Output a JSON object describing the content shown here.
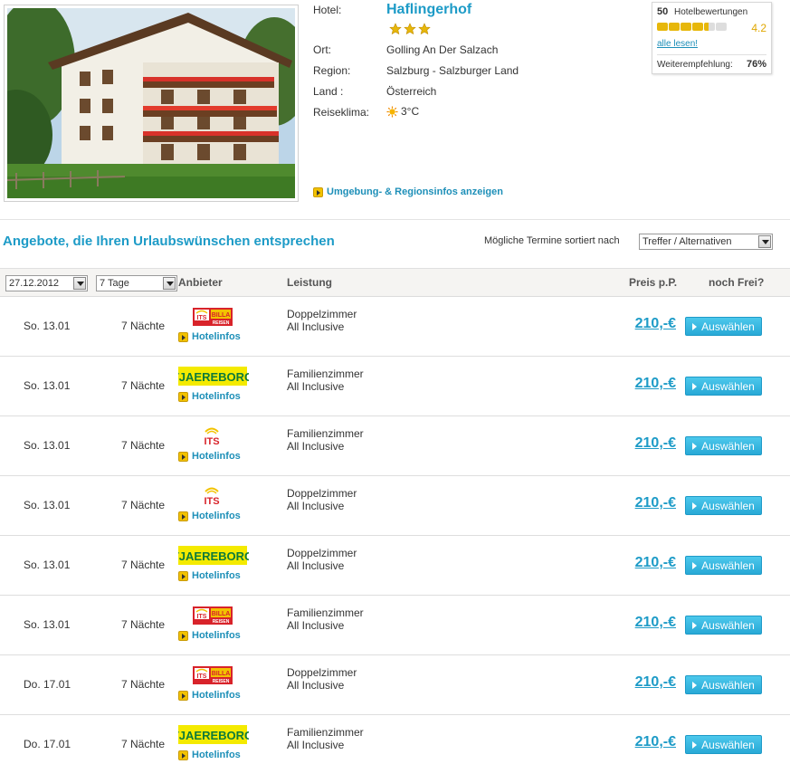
{
  "hotel": {
    "labels": {
      "hotel": "Hotel:",
      "location": "Ort:",
      "region": "Region:",
      "country": "Land :",
      "climate": "Reiseklima:"
    },
    "name": "Haflingerhof",
    "stars": 3,
    "location": "Golling An Der Salzach",
    "region": "Salzburg - Salzburger Land",
    "country": "Österreich",
    "climate": "3°C",
    "region_link": "Umgebung- & Regionsinfos anzeigen"
  },
  "rating": {
    "count": "50",
    "count_label": "Hotelbewertungen",
    "score": "4.2",
    "score_fraction": 0.84,
    "read_all": "alle lesen!",
    "recommend_label": "Weiterempfehlung:",
    "recommend_value": "76%"
  },
  "offers": {
    "title": "Angebote, die Ihren Urlaubswünschen entsprechen",
    "sort_label": "Mögliche Termine sortiert nach",
    "sort_value": "Treffer / Alternativen",
    "date_value": "27.12.2012",
    "days_value": "7 Tage",
    "headers": {
      "provider": "Anbieter",
      "service": "Leistung",
      "price": "Preis p.P.",
      "availability": "noch Frei?"
    },
    "hotelinfo_label": "Hotelinfos",
    "select_label": "Auswählen",
    "rows": [
      {
        "date": "So. 13.01",
        "nights": "7 Nächte",
        "provider": "its-billa",
        "room": "Doppelzimmer",
        "board": "All Inclusive",
        "price": "210,-€"
      },
      {
        "date": "So. 13.01",
        "nights": "7 Nächte",
        "provider": "tjaereborg",
        "room": "Familienzimmer",
        "board": "All Inclusive",
        "price": "210,-€"
      },
      {
        "date": "So. 13.01",
        "nights": "7 Nächte",
        "provider": "its",
        "room": "Familienzimmer",
        "board": "All Inclusive",
        "price": "210,-€"
      },
      {
        "date": "So. 13.01",
        "nights": "7 Nächte",
        "provider": "its",
        "room": "Doppelzimmer",
        "board": "All Inclusive",
        "price": "210,-€"
      },
      {
        "date": "So. 13.01",
        "nights": "7 Nächte",
        "provider": "tjaereborg",
        "room": "Doppelzimmer",
        "board": "All Inclusive",
        "price": "210,-€"
      },
      {
        "date": "So. 13.01",
        "nights": "7 Nächte",
        "provider": "its-billa",
        "room": "Familienzimmer",
        "board": "All Inclusive",
        "price": "210,-€"
      },
      {
        "date": "Do. 17.01",
        "nights": "7 Nächte",
        "provider": "its-billa",
        "room": "Doppelzimmer",
        "board": "All Inclusive",
        "price": "210,-€"
      },
      {
        "date": "Do. 17.01",
        "nights": "7 Nächte",
        "provider": "tjaereborg",
        "room": "Familienzimmer",
        "board": "All Inclusive",
        "price": "210,-€"
      }
    ]
  },
  "logos": {
    "its-billa": {
      "line1": "ITS",
      "line2": "BILLA",
      "line3": "REISEN"
    },
    "tjaereborg": {
      "text": "TJAEREBORG"
    },
    "its": {
      "text": "ITS"
    }
  },
  "colors": {
    "accent": "#1d9bc7",
    "button": "#28a9d6",
    "star": "#e7b70a",
    "tjaereborg_bg": "#f4ea00",
    "its_red": "#d8232a"
  }
}
